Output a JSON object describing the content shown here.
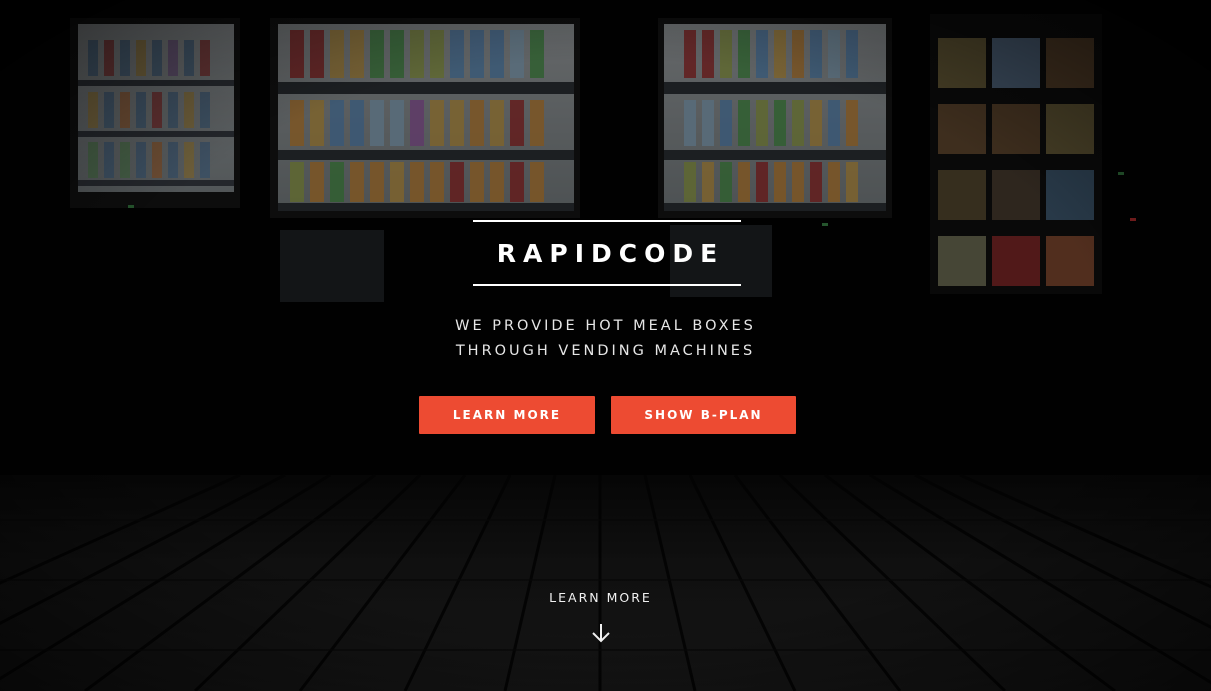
{
  "hero": {
    "logo": "RAPIDCODE",
    "tagline_line1": "WE PROVIDE HOT MEAL BOXES",
    "tagline_line2": "THROUGH VENDING MACHINES",
    "buttons": {
      "learn_more": "LEARN MORE",
      "show_bplan": "SHOW B-PLAN"
    },
    "scroll_cta": "LEARN MORE",
    "scroll_icon": "arrow-down-icon",
    "background_image": "vending machines at night on wooden deck"
  },
  "colors": {
    "accent": "#ed4b32",
    "text": "#ffffff",
    "background": "#000000"
  }
}
